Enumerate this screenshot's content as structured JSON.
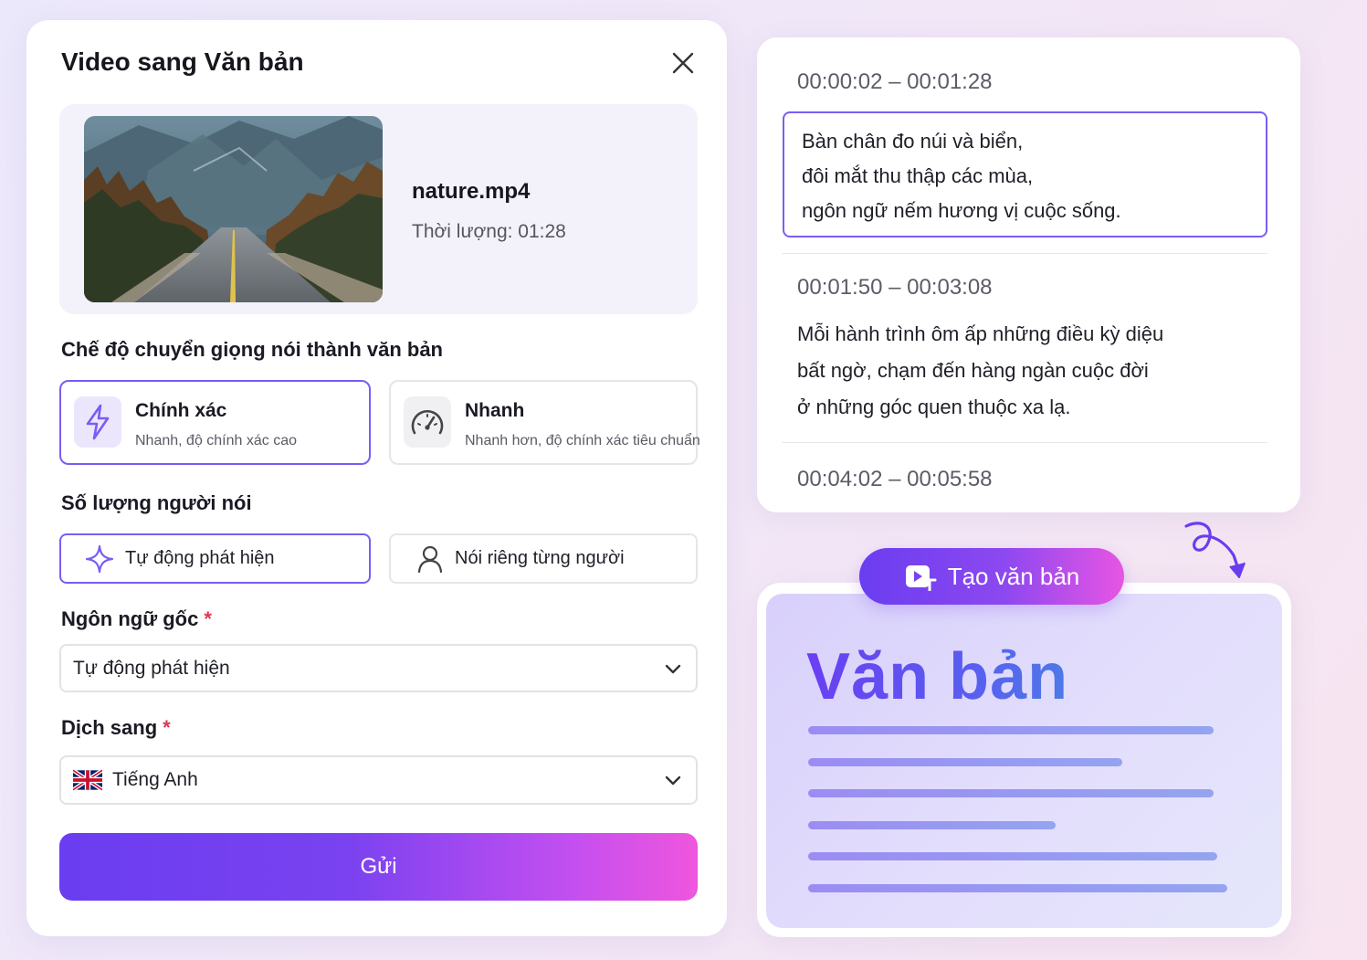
{
  "dialog": {
    "title": "Video sang Văn bản",
    "file": {
      "name": "nature.mp4",
      "duration": "Thời lượng: 01:28"
    },
    "mode_section": "Chế độ chuyển giọng nói thành văn bản",
    "modes": [
      {
        "title": "Chính xác",
        "desc": "Nhanh, độ chính xác cao",
        "icon": "lightning-icon",
        "selected": true
      },
      {
        "title": "Nhanh",
        "desc": "Nhanh hơn, độ chính xác tiêu chuẩn",
        "icon": "speedometer-icon",
        "selected": false
      }
    ],
    "speaker_section": "Số lượng người nói",
    "speakers": [
      {
        "label": "Tự động phát hiện",
        "icon": "sparkle-icon",
        "selected": true
      },
      {
        "label": "Nói riêng từng người",
        "icon": "user-icon",
        "selected": false
      }
    ],
    "source_lang": {
      "label": "Ngôn ngữ gốc",
      "required_mark": "*",
      "value": "Tự động phát hiện"
    },
    "target_lang": {
      "label": "Dịch sang",
      "required_mark": "*",
      "value": "Tiếng Anh",
      "flag": "uk-flag-icon"
    },
    "submit_label": "Gửi"
  },
  "transcript": {
    "segments": [
      {
        "time": "00:00:02 – 00:01:28",
        "lines": [
          "Bàn chân đo núi và biển,",
          "đôi mắt thu thập các mùa,",
          "ngôn ngữ nếm hương vị cuộc sống."
        ],
        "highlighted": true
      },
      {
        "time": "00:01:50 – 00:03:08",
        "lines": [
          "Mỗi hành trình ôm ấp những điều kỳ diệu",
          "bất ngờ, chạm đến hàng ngàn cuộc đời",
          "ở những góc quen thuộc xa lạ."
        ],
        "highlighted": false
      },
      {
        "time": "00:04:02 – 00:05:58",
        "lines": [],
        "highlighted": false
      }
    ]
  },
  "create_button": {
    "label": "Tạo văn bản",
    "icon": "video-text-icon"
  },
  "document": {
    "title": "Văn bản"
  },
  "colors": {
    "accent": "#7b5cf3",
    "gradient_start": "#6a3df0",
    "gradient_end": "#ef56dd"
  }
}
